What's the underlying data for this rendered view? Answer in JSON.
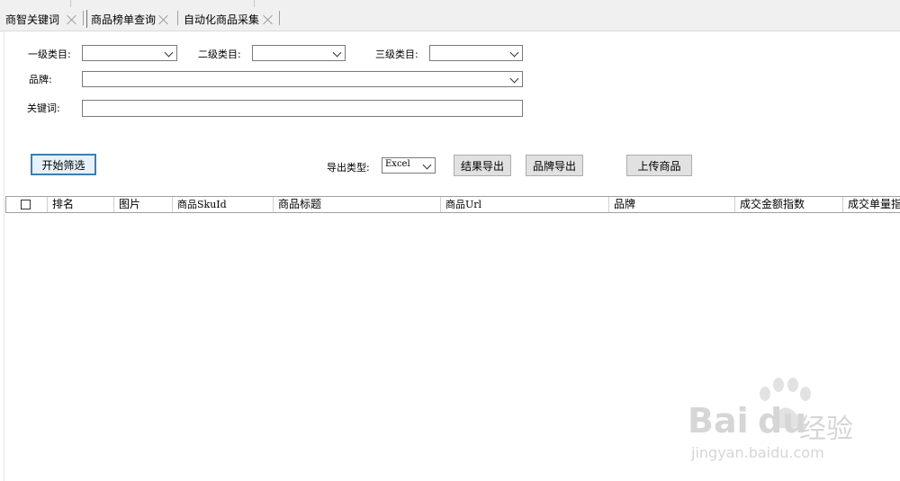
{
  "tabs": [
    {
      "label": "商智关键词",
      "active": false
    },
    {
      "label": "商品榜单查询",
      "active": true
    },
    {
      "label": "自动化商品采集",
      "active": false
    }
  ],
  "filters": {
    "category1_label": "一级类目:",
    "category2_label": "二级类目:",
    "category3_label": "三级类目:",
    "brand_label": "品牌:",
    "keyword_label": "关键词:",
    "category1_value": "",
    "category2_value": "",
    "category3_value": "",
    "brand_value": "",
    "keyword_value": ""
  },
  "actions": {
    "start_filter": "开始筛选",
    "export_type_label": "导出类型:",
    "export_type_value": "Excel",
    "export_results": "结果导出",
    "export_brand": "品牌导出",
    "upload_products": "上传商品"
  },
  "grid": {
    "columns": [
      "排名",
      "图片",
      "商品SkuId",
      "商品标题",
      "商品Url",
      "品牌",
      "成交金额指数",
      "成交单量指"
    ]
  },
  "watermark": {
    "brand": "Bai",
    "brand2": "du",
    "suffix": "经验",
    "url": "jingyan.baidu.com"
  },
  "colors": {
    "tab_bg": "#f0f0f0",
    "button_bg": "#e1e1e1",
    "primary_border": "#3c7fb1",
    "watermark": "#d6d6d6"
  }
}
